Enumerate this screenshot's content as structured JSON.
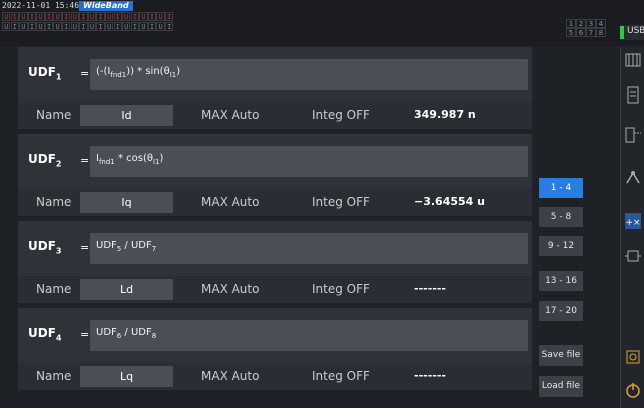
{
  "status": {
    "timestamp": "2022-11-01 15:46:14",
    "mode_badge": "WideBand",
    "channel_row1": [
      "U",
      "I",
      "U",
      "I",
      "U",
      "I",
      "U",
      "I",
      "U",
      "I",
      "U",
      "I",
      "U",
      "I",
      "U",
      "I",
      "U",
      "I",
      "U",
      "I"
    ],
    "channel_row2": [
      "U",
      "I",
      "U",
      "I",
      "U",
      "I",
      "U",
      "I",
      "U",
      "I",
      "U",
      "I",
      "U",
      "I",
      "U",
      "I",
      "U",
      "I",
      "U",
      "I"
    ],
    "grid_numbers": [
      "1",
      "2",
      "3",
      "4",
      "5",
      "6",
      "7",
      "8"
    ],
    "usb_label": "USB"
  },
  "udfs": [
    {
      "label": "UDF",
      "sub": "1",
      "expression": "(-(I_fnd1)) * sin(θ_I1)",
      "name_label": "Name",
      "name": "Id",
      "max": "MAX Auto",
      "integ": "Integ OFF",
      "value": "349.987 n"
    },
    {
      "label": "UDF",
      "sub": "2",
      "expression": "I_fnd1 * cos(θ_I1)",
      "name_label": "Name",
      "name": "Iq",
      "max": "MAX Auto",
      "integ": "Integ OFF",
      "value": "−3.64554 u"
    },
    {
      "label": "UDF",
      "sub": "3",
      "expression": "UDF5 / UDF7",
      "name_label": "Name",
      "name": "Ld",
      "max": "MAX Auto",
      "integ": "Integ OFF",
      "value": "-------"
    },
    {
      "label": "UDF",
      "sub": "4",
      "expression": "UDF6 / UDF8",
      "name_label": "Name",
      "name": "Lq",
      "max": "MAX Auto",
      "integ": "Integ OFF",
      "value": "-------"
    }
  ],
  "page_buttons": [
    "1 - 4",
    "5 - 8",
    "9 - 12",
    "13 - 16",
    "17 - 20"
  ],
  "active_page": "1 - 4",
  "file_buttons": {
    "save": "Save file",
    "load": "Load file"
  },
  "colors": {
    "accent": "#2a7de0",
    "usb_indicator": "#2ec94a",
    "channel_active": "#c03b3b"
  },
  "right_icons": [
    "wiring-icon",
    "channel-icon",
    "comm-icon",
    "efficiency-icon",
    "udf-icon",
    "motor-icon",
    "system-icon",
    "shutdown-icon"
  ]
}
